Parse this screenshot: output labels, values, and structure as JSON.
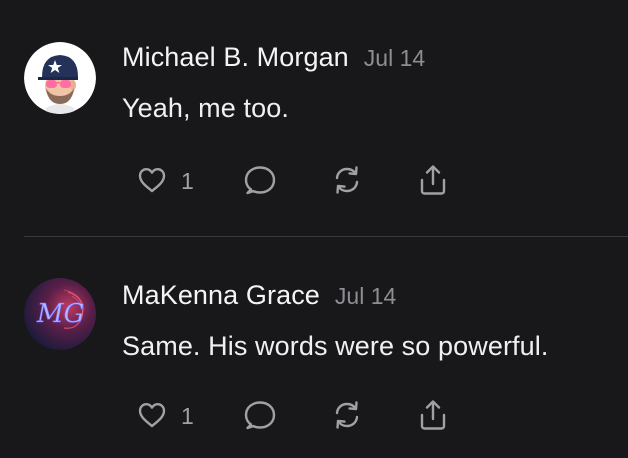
{
  "comments": [
    {
      "author": "Michael B. Morgan",
      "date": "Jul 14",
      "text": "Yeah, me too.",
      "like_count": "1",
      "avatar_icon": "cartoon-man-cap-avatar"
    },
    {
      "author": "MaKenna Grace",
      "date": "Jul 14",
      "text": "Same. His words were so powerful.",
      "like_count": "1",
      "avatar_icon": "mg-monogram-avatar",
      "avatar_monogram": "MG"
    }
  ],
  "icons": {
    "like": "heart-icon",
    "reply": "speech-bubble-icon",
    "repost": "repost-arrows-icon",
    "share": "share-upload-icon"
  },
  "colors": {
    "background": "#18181a",
    "text": "#f2f2f4",
    "muted": "#8d8d93",
    "icon": "#a0a0a6",
    "divider": "#3a3a3e"
  }
}
